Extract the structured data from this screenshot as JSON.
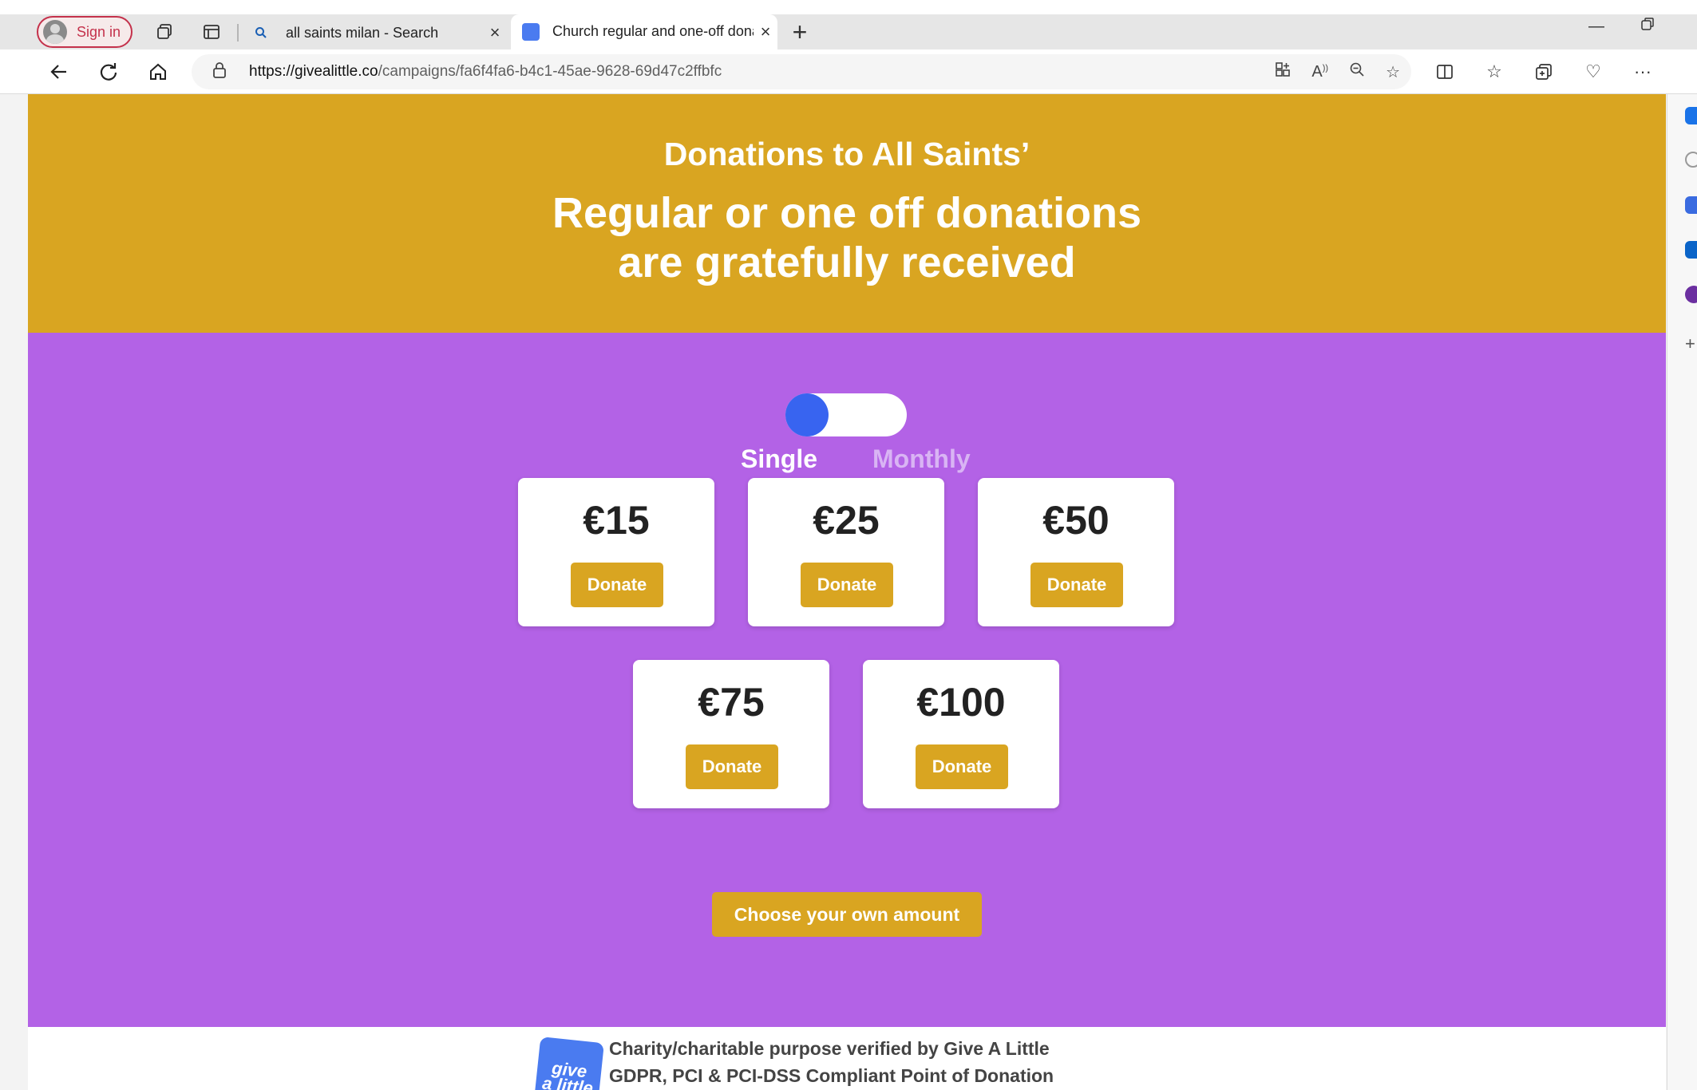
{
  "browser": {
    "signin_label": "Sign in",
    "tabs": [
      {
        "title": "all saints milan - Search"
      },
      {
        "title": "Church regular and one-off dona"
      }
    ],
    "url_host": "https://givealittle.co",
    "url_path": "/campaigns/fa6f4fa6-b4c1-45ae-9628-69d47c2ffbfc"
  },
  "hero": {
    "title": "Donations to All Saints’",
    "subtitle_line1": "Regular or one off donations",
    "subtitle_line2": "are gratefully received"
  },
  "frequency": {
    "selected": "Single",
    "single_label": "Single",
    "monthly_label": "Monthly"
  },
  "amounts": [
    {
      "value": "€15",
      "button": "Donate"
    },
    {
      "value": "€25",
      "button": "Donate"
    },
    {
      "value": "€50",
      "button": "Donate"
    },
    {
      "value": "€75",
      "button": "Donate"
    },
    {
      "value": "€100",
      "button": "Donate"
    }
  ],
  "own_amount_label": "Choose your own amount",
  "footer": {
    "logo_text_1": "give",
    "logo_text_2": "a little",
    "line1": "Charity/charitable purpose verified by Give A Little",
    "line2": "GDPR, PCI & PCI-DSS Compliant Point of Donation"
  },
  "colors": {
    "hero": "#d9a521",
    "main": "#b362e6",
    "toggle_knob": "#3864f0",
    "button": "#d9a521"
  }
}
